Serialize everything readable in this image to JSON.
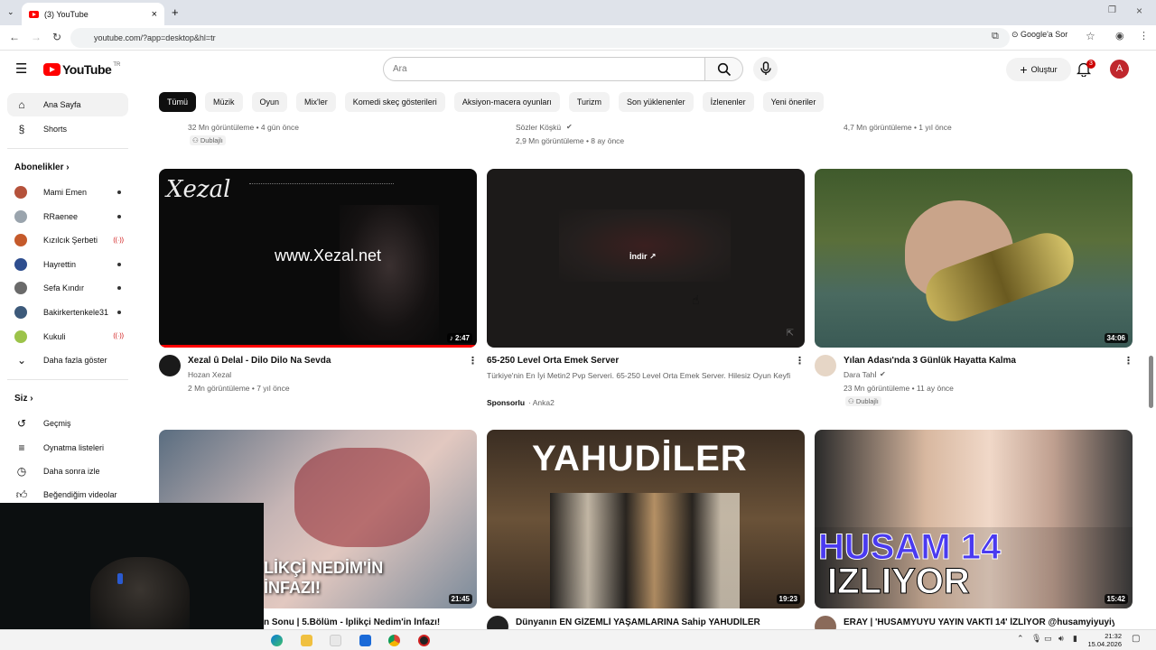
{
  "browser": {
    "tab_title": "(3) YouTube",
    "url": "youtube.com/?app=desktop&hl=tr",
    "google_sor": "Google'a Sor"
  },
  "header": {
    "logo_text": "YouTube",
    "region": "TR",
    "search_placeholder": "Ara",
    "create_label": "Oluştur",
    "notif_count": "3",
    "avatar_letter": "A"
  },
  "sidebar": {
    "home": "Ana Sayfa",
    "shorts": "Shorts",
    "subs_title": "Abonelikler",
    "subs": [
      {
        "name": "Mami Emen",
        "color": "#b5523b",
        "live": false
      },
      {
        "name": "RRaenee",
        "color": "#9aa4ad",
        "live": false
      },
      {
        "name": "Kızılcık Şerbeti",
        "color": "#c55a2b",
        "live": true
      },
      {
        "name": "Hayrettin",
        "color": "#2e4e8f",
        "live": false
      },
      {
        "name": "Sefa Kındır",
        "color": "#6a6a6a",
        "live": false
      },
      {
        "name": "Bakirkertenkele31",
        "color": "#3d5a7a",
        "live": false
      },
      {
        "name": "Kukuli",
        "color": "#9cc34a",
        "live": true
      }
    ],
    "show_more": "Daha fazla göster",
    "you_title": "Siz",
    "you_items": [
      "Geçmiş",
      "Oynatma listeleri",
      "Daha sonra izle",
      "Beğendiğim videolar"
    ]
  },
  "chips": [
    "Tümü",
    "Müzik",
    "Oyun",
    "Mix'ler",
    "Komedi skeç gösterileri",
    "Aksiyon-macera oyunları",
    "Turizm",
    "Son yüklenenler",
    "İzlenenler",
    "Yeni öneriler"
  ],
  "prev_row": [
    {
      "meta": "32 Mn görüntüleme • 4 gün önce",
      "dub": "Dublajlı"
    },
    {
      "channel": "Sözler Köşkü",
      "meta": "2,9 Mn görüntüleme • 8 ay önce"
    },
    {
      "meta": "4,7 Mn görüntüleme • 1 yıl önce"
    }
  ],
  "row1": [
    {
      "title": "Xezal û Delal - Dilo Dilo Na Sevda",
      "channel": "Hozan Xezal",
      "meta": "2 Mn görüntüleme • 7 yıl önce",
      "duration": "2:47",
      "thumb_title": "www.Xezal.net",
      "thumb_logo": "Xezal"
    },
    {
      "title": "65-250 Level Orta Emek Server",
      "desc": "Türkiye'nin En İyi Metin2 Pvp Serveri. 65-250 Level Orta Emek Server. Hilesiz Oyun Keyfi",
      "sponsor": "Sponsorlu",
      "channel": "Anka2",
      "thumb_label": "İndir"
    },
    {
      "title": "Yılan Adası'nda 3 Günlük Hayatta Kalma",
      "channel": "Dara Tahİ",
      "meta": "23 Mn görüntüleme • 11 ay önce",
      "duration": "34:06",
      "dub": "Dublajlı"
    }
  ],
  "row2": [
    {
      "title": "n Sonu | 5.Bölüm - İplikçi Nedim'in İnfazı!",
      "duration": "21:45",
      "thumb_text": "LİKÇİ NEDİM'İN İNFAZI!"
    },
    {
      "title": "Dünyanın EN GİZEMLİ YAŞAMLARINA Sahip YAHUDİLER",
      "duration": "19:23",
      "thumb_text": "YAHUDİLER"
    },
    {
      "title": "ERAY | 'HUSAMYUYU YAYIN VAKTİ 14' İZLİYOR @husamyiyuyiyu",
      "duration": "15:42",
      "thumb_text_1": "HUSAM 14",
      "thumb_text_2": "IZLIYOR"
    }
  ],
  "clock": {
    "time": "21:32",
    "date": "15.04.2026"
  }
}
